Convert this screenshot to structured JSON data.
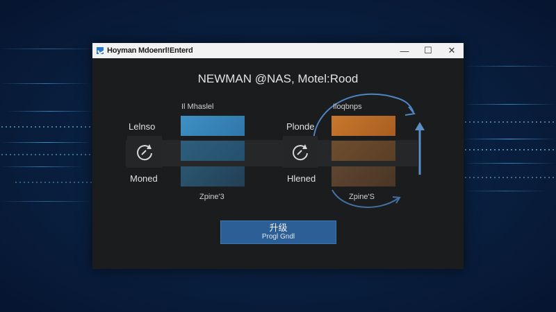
{
  "window": {
    "title": "Hoyman Mdoenrl!Enterd",
    "controls": {
      "minimize": "—",
      "maximize": "☐",
      "close": "✕"
    }
  },
  "main": {
    "heading": "NEWMAN @NAS, Motel:Rood",
    "left_panel": {
      "column_label": "Il Mhaslel",
      "top_label": "Lelnso",
      "bottom_label": "Moned",
      "footer_label": "Zpine'3"
    },
    "right_panel": {
      "column_label": "Iloqbnps",
      "top_label": "Plonde",
      "bottom_label": "Hlened",
      "footer_label": "Zpine'S"
    },
    "upgrade_button": {
      "label": "升级",
      "sublabel": "Progl Gndl"
    }
  },
  "colors": {
    "window_bg": "#1b1c1e",
    "titlebar_bg": "#f2f2f2",
    "left_swatch": "#3a86b8",
    "right_swatch": "#c0722a",
    "button_bg": "#2c5f95",
    "arrow": "#5b8fc6"
  },
  "icons": [
    "app-icon",
    "refresh-icon",
    "circular-arrow-icon",
    "up-arrow-icon"
  ]
}
